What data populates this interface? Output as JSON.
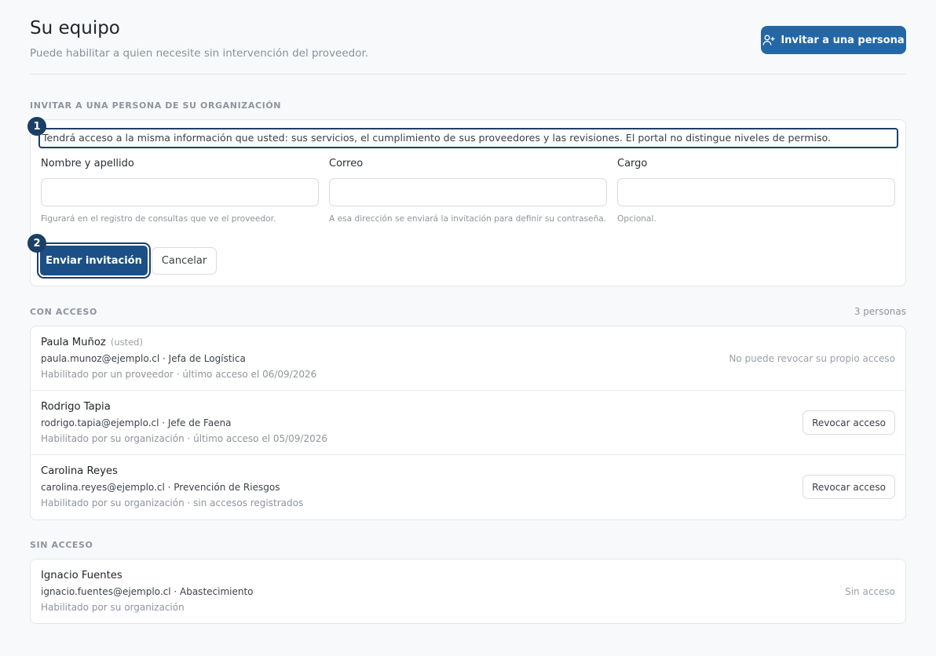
{
  "header": {
    "title": "Su equipo",
    "subtitle": "Puede habilitar a quien necesite sin intervención del proveedor.",
    "invite_button": "Invitar a una persona",
    "invite_icon": "user-plus-icon"
  },
  "invite_section": {
    "label": "INVITAR A UNA PERSONA DE SU ORGANIZACIÓN",
    "notice": "Tendrá acceso a la misma información que usted: sus servicios, el cumplimiento de sus proveedores y las revisiones. El portal no distingue niveles de permiso.",
    "badge_1": "1",
    "badge_2": "2",
    "fields": [
      {
        "label": "Nombre y apellido",
        "value": "",
        "help": "Figurará en el registro de consultas que ve el proveedor."
      },
      {
        "label": "Correo",
        "value": "",
        "help": "A esa dirección se enviará la invitación para definir su contraseña."
      },
      {
        "label": "Cargo",
        "value": "",
        "help": "Opcional."
      }
    ],
    "send_button": "Enviar invitación",
    "cancel_button": "Cancelar"
  },
  "with_access": {
    "label": "CON ACCESO",
    "count": "3 personas",
    "people": [
      {
        "name": "Paula Muñoz",
        "you_tag": "(usted)",
        "email_role": "paula.munoz@ejemplo.cl · Jefa de Logística",
        "meta": "Habilitado por un proveedor · último acceso el 06/09/2026",
        "status": "No puede revocar su propio acceso"
      },
      {
        "name": "Rodrigo Tapia",
        "email_role": "rodrigo.tapia@ejemplo.cl · Jefe de Faena",
        "meta": "Habilitado por su organización · último acceso el 05/09/2026",
        "action": "Revocar acceso"
      },
      {
        "name": "Carolina Reyes",
        "email_role": "carolina.reyes@ejemplo.cl · Prevención de Riesgos",
        "meta": "Habilitado por su organización · sin accesos registrados",
        "action": "Revocar acceso"
      }
    ]
  },
  "without_access": {
    "label": "SIN ACCESO",
    "people": [
      {
        "name": "Ignacio Fuentes",
        "email_role": "ignacio.fuentes@ejemplo.cl · Abastecimiento",
        "meta": "Habilitado por su organización",
        "status": "Sin acceso"
      }
    ]
  },
  "colors": {
    "primary": "#2467a6",
    "focus_ring": "#1b3f66",
    "background": "#f8f9fa"
  }
}
